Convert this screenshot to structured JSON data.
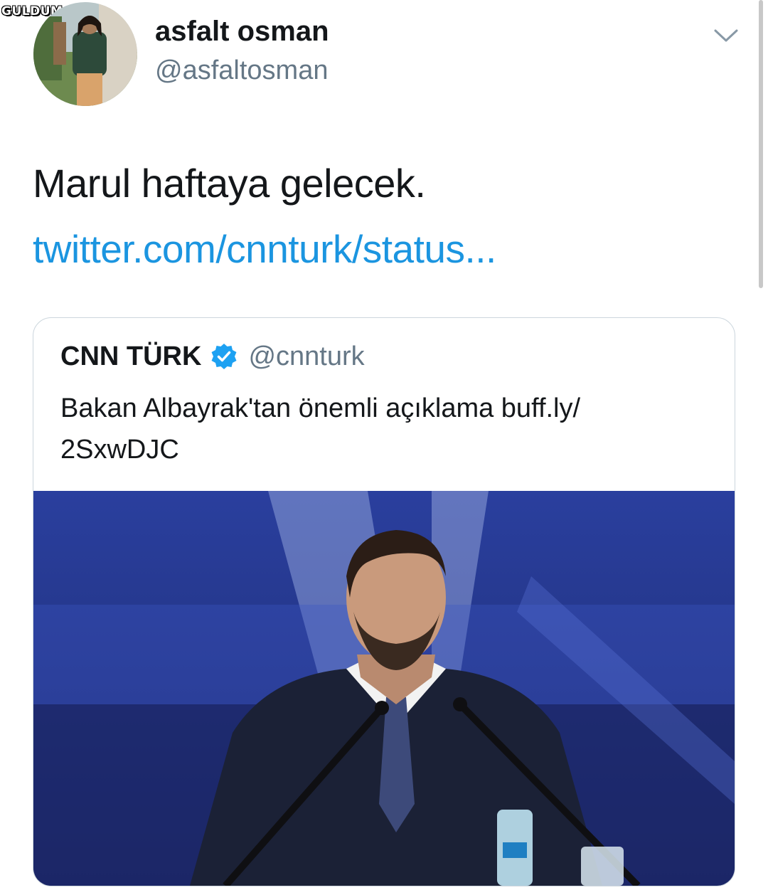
{
  "watermark": "GULDUM.NET",
  "author": {
    "name": "asfalt osman",
    "handle": "@asfaltosman",
    "avatar_icon": "profile-photo"
  },
  "menu": {
    "icon": "chevron-down-icon"
  },
  "tweet": {
    "text": "Marul haftaya gelecek.",
    "link": "twitter.com/cnnturk/status..."
  },
  "quoted": {
    "name": "CNN TÜRK",
    "verified_icon": "verified-badge-icon",
    "handle": "@cnnturk",
    "text_line1": "Bakan Albayrak'tan önemli açıklama buff.ly/",
    "text_line2": "2SxwDJC",
    "media": "photo-speaker-at-podium"
  },
  "colors": {
    "link": "#1b95e0",
    "secondary_text": "#657786",
    "border": "#ccd6dd",
    "verified": "#1da1f2"
  }
}
